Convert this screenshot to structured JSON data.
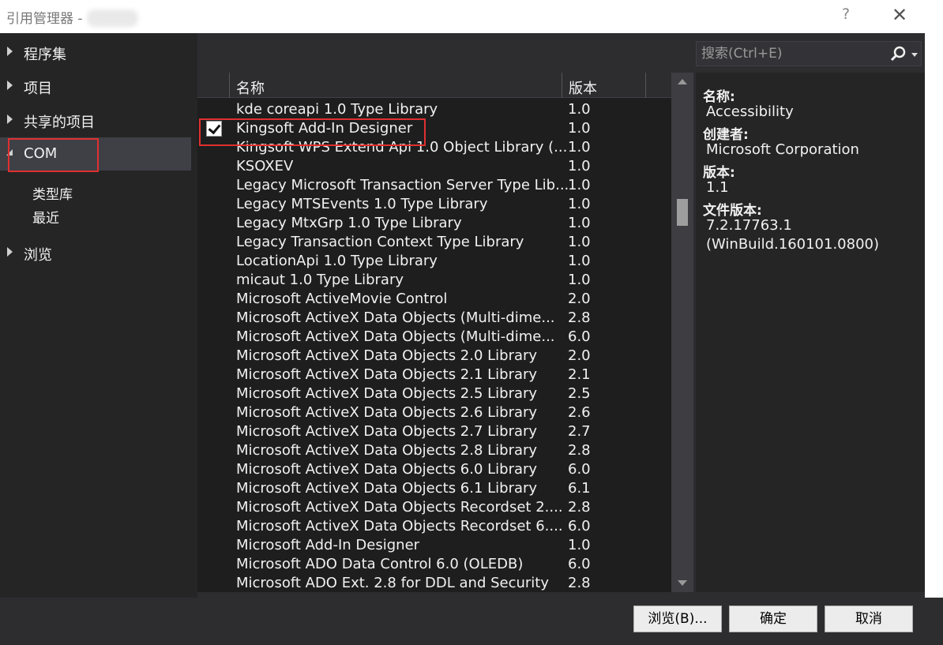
{
  "window": {
    "title": "引用管理器 -",
    "help_glyph": "?",
    "close_glyph": "✕"
  },
  "nav": {
    "items": [
      {
        "label": "程序集"
      },
      {
        "label": "项目"
      },
      {
        "label": "共享的项目"
      },
      {
        "label": "COM"
      },
      {
        "label": "浏览"
      }
    ],
    "com_children": [
      {
        "label": "类型库"
      },
      {
        "label": "最近"
      }
    ]
  },
  "search": {
    "placeholder": "搜索(Ctrl+E)"
  },
  "list": {
    "columns": {
      "name": "名称",
      "version": "版本"
    },
    "rows": [
      {
        "name": "kde coreapi 1.0 Type Library",
        "version": "1.0",
        "checked": false
      },
      {
        "name": "Kingsoft Add-In Designer",
        "version": "1.0",
        "checked": true
      },
      {
        "name": "Kingsoft WPS Extend Api 1.0 Object Library (...",
        "version": "1.0",
        "checked": false
      },
      {
        "name": "KSOXEV",
        "version": "1.0",
        "checked": false
      },
      {
        "name": "Legacy Microsoft Transaction Server Type Lib...",
        "version": "1.0",
        "checked": false
      },
      {
        "name": "Legacy MTSEvents 1.0 Type Library",
        "version": "1.0",
        "checked": false
      },
      {
        "name": "Legacy MtxGrp 1.0 Type Library",
        "version": "1.0",
        "checked": false
      },
      {
        "name": "Legacy Transaction Context Type Library",
        "version": "1.0",
        "checked": false
      },
      {
        "name": "LocationApi 1.0 Type Library",
        "version": "1.0",
        "checked": false
      },
      {
        "name": "micaut 1.0 Type Library",
        "version": "1.0",
        "checked": false
      },
      {
        "name": "Microsoft ActiveMovie Control",
        "version": "2.0",
        "checked": false
      },
      {
        "name": "Microsoft ActiveX Data Objects (Multi-dime...",
        "version": "2.8",
        "checked": false
      },
      {
        "name": "Microsoft ActiveX Data Objects (Multi-dime...",
        "version": "6.0",
        "checked": false
      },
      {
        "name": "Microsoft ActiveX Data Objects 2.0 Library",
        "version": "2.0",
        "checked": false
      },
      {
        "name": "Microsoft ActiveX Data Objects 2.1 Library",
        "version": "2.1",
        "checked": false
      },
      {
        "name": "Microsoft ActiveX Data Objects 2.5 Library",
        "version": "2.5",
        "checked": false
      },
      {
        "name": "Microsoft ActiveX Data Objects 2.6 Library",
        "version": "2.6",
        "checked": false
      },
      {
        "name": "Microsoft ActiveX Data Objects 2.7 Library",
        "version": "2.7",
        "checked": false
      },
      {
        "name": "Microsoft ActiveX Data Objects 2.8 Library",
        "version": "2.8",
        "checked": false
      },
      {
        "name": "Microsoft ActiveX Data Objects 6.0 Library",
        "version": "6.0",
        "checked": false
      },
      {
        "name": "Microsoft ActiveX Data Objects 6.1 Library",
        "version": "6.1",
        "checked": false
      },
      {
        "name": "Microsoft ActiveX Data Objects Recordset 2....",
        "version": "2.8",
        "checked": false
      },
      {
        "name": "Microsoft ActiveX Data Objects Recordset 6....",
        "version": "6.0",
        "checked": false
      },
      {
        "name": "Microsoft Add-In Designer",
        "version": "1.0",
        "checked": false
      },
      {
        "name": "Microsoft ADO Data Control 6.0 (OLEDB)",
        "version": "6.0",
        "checked": false
      },
      {
        "name": "Microsoft ADO Ext. 2.8 for DDL and Security",
        "version": "2.8",
        "checked": false
      }
    ]
  },
  "details": {
    "name_label": "名称:",
    "name_value": "Accessibility",
    "creator_label": "创建者:",
    "creator_value": "Microsoft Corporation",
    "version_label": "版本:",
    "version_value": "1.1",
    "file_version_label": "文件版本:",
    "file_version_value_1": "7.2.17763.1",
    "file_version_value_2": "(WinBuild.160101.0800)"
  },
  "buttons": {
    "browse": "浏览(B)...",
    "ok": "确定",
    "cancel": "取消"
  },
  "colors": {
    "background": "#2d2d30",
    "list_bg": "#1e1e1e",
    "highlight_box": "#e03030"
  }
}
